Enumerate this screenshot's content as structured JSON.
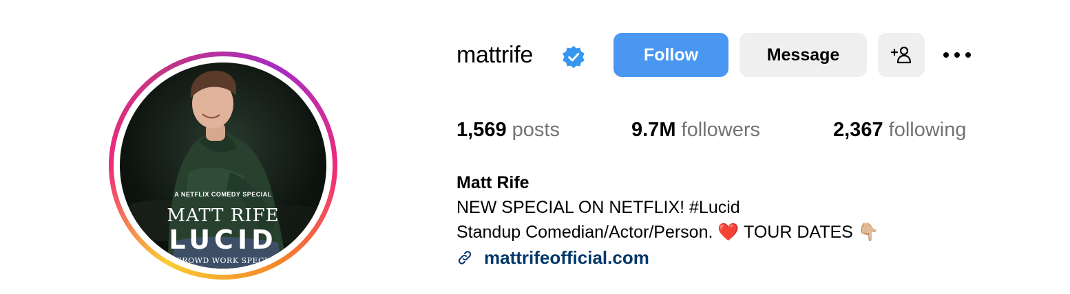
{
  "profile": {
    "username": "mattrife",
    "verified": true,
    "full_name": "Matt Rife",
    "avatar": {
      "kicker": "A NETFLIX COMEDY SPECIAL",
      "name": "MATT RIFE",
      "title": "LUCID",
      "subtitle": "A CROWD WORK SPECIAL"
    }
  },
  "actions": {
    "follow_label": "Follow",
    "message_label": "Message",
    "suggest_icon": "person-plus-icon",
    "more_icon": "more-horizontal-icon"
  },
  "stats": {
    "posts_count": "1,569",
    "posts_label": "posts",
    "followers_count": "9.7M",
    "followers_label": "followers",
    "following_count": "2,367",
    "following_label": "following"
  },
  "bio": {
    "line1": "NEW SPECIAL ON NETFLIX! #Lucid",
    "line2": "Standup Comedian/Actor/Person. ❤️ TOUR DATES 👇🏼",
    "link_icon": "link-icon",
    "link_text": "mattrifeofficial.com"
  },
  "colors": {
    "follow_button": "#4a97f1",
    "secondary_button": "#efefef",
    "muted_text": "#737373",
    "link_text": "#00376b",
    "verified_badge": "#3797f0"
  }
}
